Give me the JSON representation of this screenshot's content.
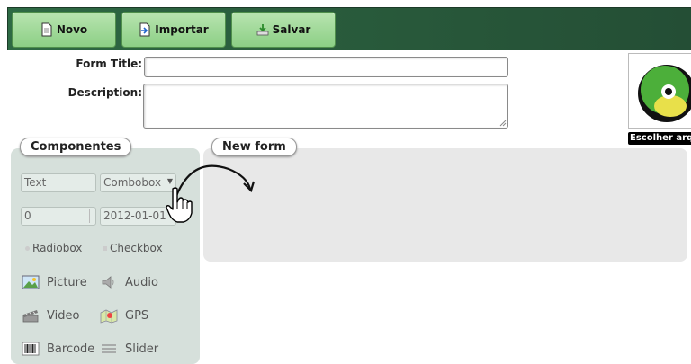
{
  "toolbar": {
    "buttons": [
      {
        "label": "Novo",
        "icon": "document-icon"
      },
      {
        "label": "Importar",
        "icon": "import-icon"
      },
      {
        "label": "Salvar",
        "icon": "save-icon"
      }
    ]
  },
  "form": {
    "title_label": "Form Title:",
    "title_value": "",
    "description_label": "Description:",
    "description_value": ""
  },
  "logo": {
    "choose_label": "Escolher arquivo"
  },
  "components": {
    "tab_label": "Componentes",
    "text_field": "Text",
    "combobox": "Combobox",
    "number_value": "0",
    "date_value": "2012-01-01",
    "radiobox": "Radiobox",
    "checkbox": "Checkbox",
    "items": [
      {
        "label": "Picture",
        "icon": "picture-icon"
      },
      {
        "label": "Audio",
        "icon": "audio-icon"
      },
      {
        "label": "Video",
        "icon": "video-icon"
      },
      {
        "label": "GPS",
        "icon": "gps-icon"
      },
      {
        "label": "Barcode",
        "icon": "barcode-icon"
      },
      {
        "label": "Slider",
        "icon": "slider-icon"
      }
    ]
  },
  "new_form": {
    "tab_label": "New form"
  },
  "colors": {
    "toolbar": "#2a5e3d",
    "button": "#a6dc9e",
    "components_panel": "#d6e0db",
    "form_panel": "#e8e8e8"
  }
}
